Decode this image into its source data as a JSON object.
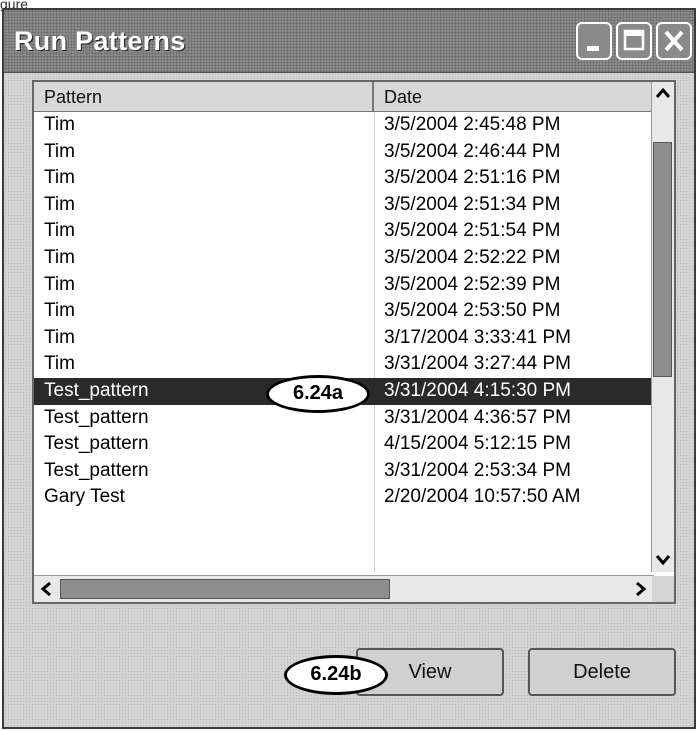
{
  "figure_tag": "gure",
  "window": {
    "title": "Run Patterns",
    "controls": {
      "minimize_icon": "minimize-icon",
      "maximize_icon": "maximize-icon",
      "close_icon": "close-icon"
    }
  },
  "list": {
    "columns": [
      "Pattern",
      "Date"
    ],
    "selected_index": 10,
    "rows": [
      {
        "pattern": "Tim",
        "date": "3/5/2004 2:45:48 PM"
      },
      {
        "pattern": "Tim",
        "date": "3/5/2004 2:46:44 PM"
      },
      {
        "pattern": "Tim",
        "date": "3/5/2004 2:51:16 PM"
      },
      {
        "pattern": "Tim",
        "date": "3/5/2004 2:51:34 PM"
      },
      {
        "pattern": "Tim",
        "date": "3/5/2004 2:51:54 PM"
      },
      {
        "pattern": "Tim",
        "date": "3/5/2004 2:52:22 PM"
      },
      {
        "pattern": "Tim",
        "date": "3/5/2004 2:52:39 PM"
      },
      {
        "pattern": "Tim",
        "date": "3/5/2004 2:53:50 PM"
      },
      {
        "pattern": "Tim",
        "date": "3/17/2004 3:33:41 PM"
      },
      {
        "pattern": "Tim",
        "date": "3/31/2004 3:27:44 PM"
      },
      {
        "pattern": "Test_pattern",
        "date": "3/31/2004 4:15:30 PM"
      },
      {
        "pattern": "Test_pattern",
        "date": "3/31/2004 4:36:57 PM"
      },
      {
        "pattern": "Test_pattern",
        "date": "4/15/2004 5:12:15 PM"
      },
      {
        "pattern": "Test_pattern",
        "date": "3/31/2004 2:53:34 PM"
      },
      {
        "pattern": "Gary Test",
        "date": "2/20/2004 10:57:50 AM"
      }
    ]
  },
  "callouts": {
    "row": "6.24a",
    "view": "6.24b"
  },
  "buttons": {
    "view": "View",
    "delete": "Delete"
  }
}
